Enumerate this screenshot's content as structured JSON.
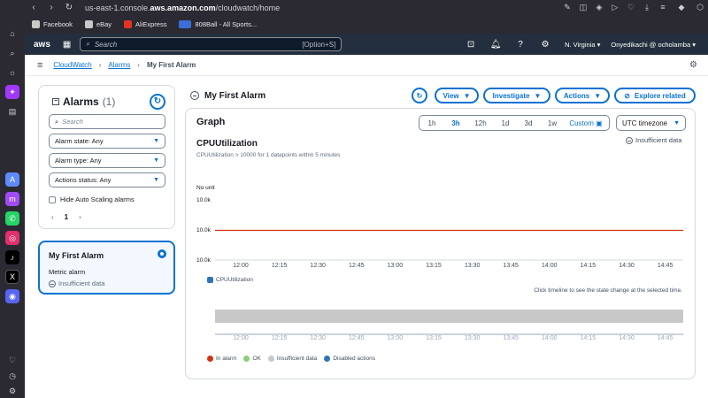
{
  "browser": {
    "url_prefix": "us-east-1.console.",
    "url_domain": "aws.amazon.com",
    "url_path": "/cloudwatch/home",
    "bookmarks": [
      "Facebook",
      "eBay",
      "AliExpress",
      "808Ball - All Sports..."
    ]
  },
  "aws_header": {
    "logo": "aws",
    "search_placeholder": "Search",
    "search_shortcut": "[Option+S]",
    "region": "N. Virginia",
    "account": "Onyedikachi @ ocholamba"
  },
  "breadcrumb": {
    "items": [
      "CloudWatch",
      "Alarms"
    ],
    "current": "My First Alarm"
  },
  "alarms_panel": {
    "title": "Alarms",
    "count": "(1)",
    "search_placeholder": "Search",
    "filters": [
      "Alarm state: Any",
      "Alarm type: Any",
      "Actions status: Any"
    ],
    "hide_autoscaling_label": "Hide Auto Scaling alarms",
    "page": "1"
  },
  "alarm_card": {
    "name": "My First Alarm",
    "type": "Metric alarm",
    "state": "Insufficient data"
  },
  "main": {
    "title": "My First Alarm",
    "buttons": {
      "view": "View",
      "investigate": "Investigate",
      "actions": "Actions",
      "explore": "Explore related"
    }
  },
  "graph": {
    "title": "Graph",
    "ranges": [
      "1h",
      "3h",
      "12h",
      "1d",
      "3d",
      "1w"
    ],
    "active_range": "3h",
    "custom": "Custom",
    "timezone": "UTC timezone",
    "metric_title": "CPUUtilization",
    "metric_subtitle": "CPUUtilization > 10000 for 1 datapoints within 5 minutes",
    "state_label": "Insufficient data",
    "unit": "No unit",
    "hint": "Click timeline to see the state change at the selected time.",
    "legend_series": "CPUUtilization",
    "status_legend": [
      {
        "label": "In alarm",
        "color": "#d13212"
      },
      {
        "label": "OK",
        "color": "#88d07a"
      },
      {
        "label": "Insufficient data",
        "color": "#c8c8c8"
      },
      {
        "label": "Disabled actions",
        "color": "#2e74b5"
      }
    ]
  },
  "chart_data": {
    "type": "line",
    "ylabel": "No unit",
    "y_tick_labels": [
      "10.0k",
      "10.0k",
      "10.0k"
    ],
    "x_ticks": [
      "12:00",
      "12:15",
      "12:30",
      "12:45",
      "13:00",
      "13:15",
      "13:30",
      "13:45",
      "14:00",
      "14:15",
      "14:30",
      "14:45"
    ],
    "threshold": {
      "value": 10000,
      "color": "#d13212"
    },
    "series": [
      {
        "name": "CPUUtilization",
        "values": []
      }
    ],
    "legend": "bottom-left"
  }
}
